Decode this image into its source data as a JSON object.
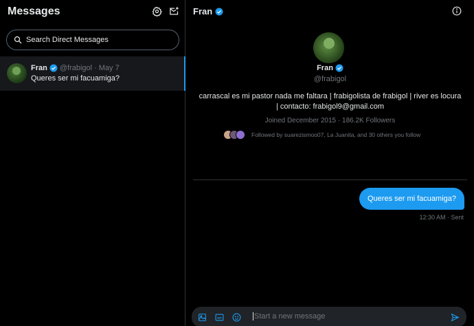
{
  "sidebar": {
    "title": "Messages",
    "settings_icon": "gear-icon",
    "new_message_icon": "new-message-icon",
    "search_placeholder": "Search Direct Messages",
    "conversations": [
      {
        "name": "Fran",
        "verified": true,
        "handle": "@frabigol",
        "separator": "·",
        "date": "May 7",
        "last_message": "Queres ser mi facuamiga?",
        "selected": true
      }
    ]
  },
  "chat": {
    "header_name": "Fran",
    "info_icon": "info-icon",
    "profile": {
      "name": "Fran",
      "handle": "@frabigol",
      "bio": "carrascal es mi pastor nada me faltara | frabigolista de frabigol | river es locura | contacto: frabigol9@gmail.com",
      "joined": "Joined December 2015 · 186.2K Followers",
      "followed_by": "Followed by suarezismoo07, La Juanita, and 30 others you follow"
    },
    "messages": [
      {
        "text": "Queres ser mi facuamiga?",
        "meta": "12:30 AM · Sent",
        "outgoing": true
      }
    ],
    "composer": {
      "placeholder": "Start a new message"
    }
  },
  "colors": {
    "accent": "#1d9bf0",
    "background": "#000000",
    "muted_text": "#71767b",
    "text": "#e7e9ea",
    "border": "#2f3336"
  }
}
